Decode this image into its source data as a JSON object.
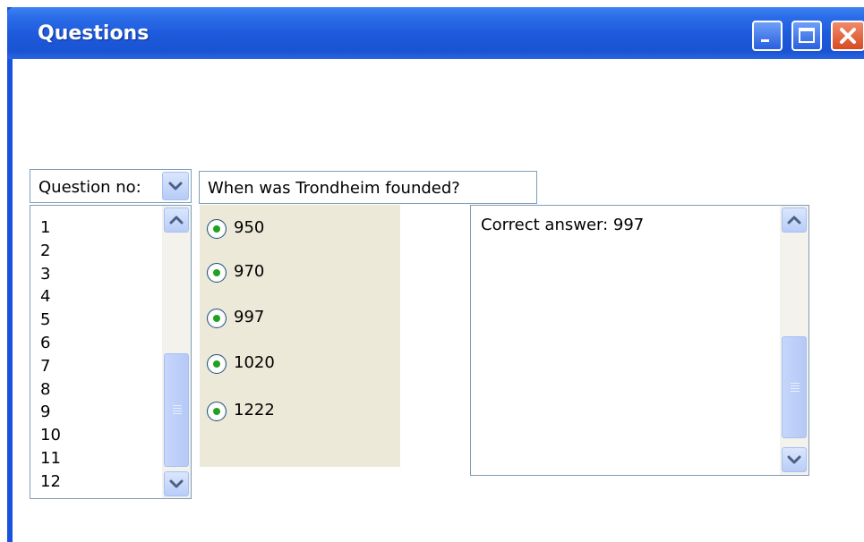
{
  "window": {
    "title": "Questions",
    "controls": [
      "minimize",
      "maximize",
      "close"
    ]
  },
  "question_selector": {
    "label": "Question no:",
    "items": [
      "1",
      "2",
      "3",
      "4",
      "5",
      "6",
      "7",
      "8",
      "9",
      "10",
      "11",
      "12"
    ]
  },
  "question": {
    "text": "When was Trondheim founded?"
  },
  "options": [
    {
      "label": "950"
    },
    {
      "label": "970"
    },
    {
      "label": "997"
    },
    {
      "label": "1020"
    },
    {
      "label": "1222"
    }
  ],
  "answer": {
    "text": "Correct answer: 997"
  },
  "colors": {
    "titlebar": "#1d59db",
    "option_panel": "#ece9d8",
    "radio_dot": "#21a121",
    "field_border": "#7f9db9"
  },
  "icons": {
    "minimize": "minimize-icon",
    "maximize": "maximize-icon",
    "close": "close-icon",
    "dropdown": "chevron-down-icon",
    "scroll_up": "chevron-up-icon",
    "scroll_down": "chevron-down-icon"
  }
}
